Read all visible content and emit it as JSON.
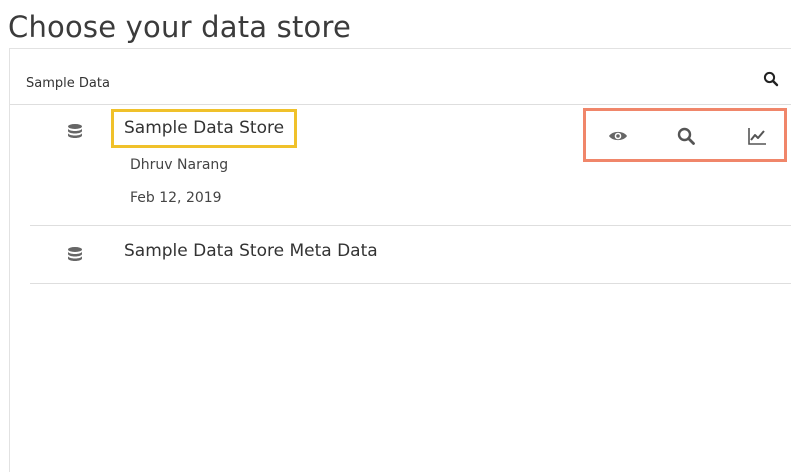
{
  "page": {
    "title": "Choose your data store"
  },
  "panel": {
    "header_label": "Sample Data",
    "search_icon": "search-icon"
  },
  "items": [
    {
      "title": "Sample Data Store",
      "author": "Dhruv Narang",
      "date": "Feb 12, 2019",
      "icon": "database-icon",
      "actions": [
        "eye-icon",
        "search-icon",
        "line-chart-icon"
      ]
    },
    {
      "title": "Sample Data Store Meta Data",
      "icon": "database-icon"
    }
  ],
  "colors": {
    "title_highlight": "#f0c12a",
    "actions_highlight": "#f0866a",
    "icon_gray": "#666666",
    "divider": "#dedede"
  }
}
